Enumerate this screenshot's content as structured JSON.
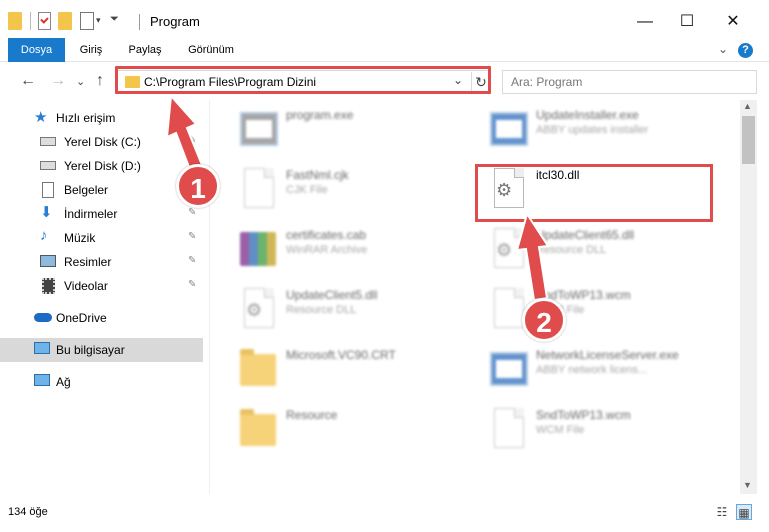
{
  "window": {
    "title": "Program",
    "minimize": "—",
    "maximize": "☐",
    "close": "✕"
  },
  "ribbon": {
    "tabs": [
      "Dosya",
      "Giriş",
      "Paylaş",
      "Görünüm"
    ],
    "expand": "⌄",
    "help": "?"
  },
  "nav": {
    "back": "←",
    "forward": "→",
    "recent": "⌄",
    "up": "↑",
    "address": "C:\\Program Files\\Program Dizini",
    "address_drop": "⌄",
    "refresh": "↻",
    "search_placeholder": "Ara: Program"
  },
  "sidebar": {
    "quick_access": "Hızlı erişim",
    "items": [
      {
        "label": "Yerel Disk (C:)",
        "pinned": true
      },
      {
        "label": "Yerel Disk (D:)",
        "pinned": true
      },
      {
        "label": "Belgeler",
        "pinned": true
      },
      {
        "label": "İndirmeler",
        "pinned": true
      },
      {
        "label": "Müzik",
        "pinned": true
      },
      {
        "label": "Resimler",
        "pinned": true
      },
      {
        "label": "Videolar",
        "pinned": true
      }
    ],
    "pin_glyph": "📌",
    "onedrive": "OneDrive",
    "this_pc": "Bu bilgisayar",
    "network": "Ağ"
  },
  "files": [
    {
      "name": "program.exe",
      "desc": ""
    },
    {
      "name": "UpdateInstaller.exe",
      "desc": "ABBY updates installer"
    },
    {
      "name": "FastNml.cjk",
      "desc": "CJK File"
    },
    {
      "name": "itcl30.dll",
      "desc": ""
    },
    {
      "name": "certificates.cab",
      "desc": "WinRAR Archive"
    },
    {
      "name": "UpdateClient65.dll",
      "desc": "Resource DLL"
    },
    {
      "name": "UpdateClient5.dll",
      "desc": "Resource DLL"
    },
    {
      "name": "SndToWP13.wcm",
      "desc": "WCM File"
    },
    {
      "name": "Microsoft.VC90.CRT",
      "desc": ""
    },
    {
      "name": "NetworkLicenseServer.exe",
      "desc": "ABBY network licens..."
    },
    {
      "name": "Resource",
      "desc": ""
    },
    {
      "name": "SndToWP13.wcm",
      "desc": "WCM File"
    }
  ],
  "status": {
    "count": "134 öğe"
  },
  "annotations": {
    "step1": "1",
    "step2": "2",
    "color": "#e04b4b"
  }
}
